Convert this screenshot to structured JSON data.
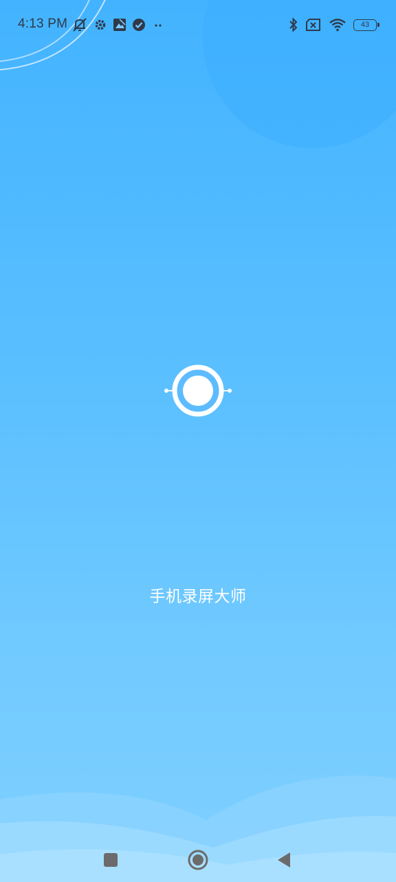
{
  "status_bar": {
    "time": "4:13 PM",
    "battery_level": "43",
    "left_icons": [
      "notification-muted-icon",
      "settings-icon",
      "photo-icon",
      "check-circle-icon",
      "more-dots-icon"
    ],
    "right_icons": [
      "bluetooth-icon",
      "no-sim-icon",
      "wifi-icon",
      "battery-icon"
    ]
  },
  "splash": {
    "app_name": "手机录屏大师",
    "logo_icon": "record-button-icon"
  },
  "nav_bar": {
    "buttons": [
      "recents-square-icon",
      "home-circle-icon",
      "back-triangle-icon"
    ]
  },
  "colors": {
    "background_top": "#43b3ff",
    "background_bottom": "#7fd0ff",
    "status_text": "#2e3a4a",
    "nav_icon": "#6b6b6b",
    "logo": "#ffffff"
  }
}
